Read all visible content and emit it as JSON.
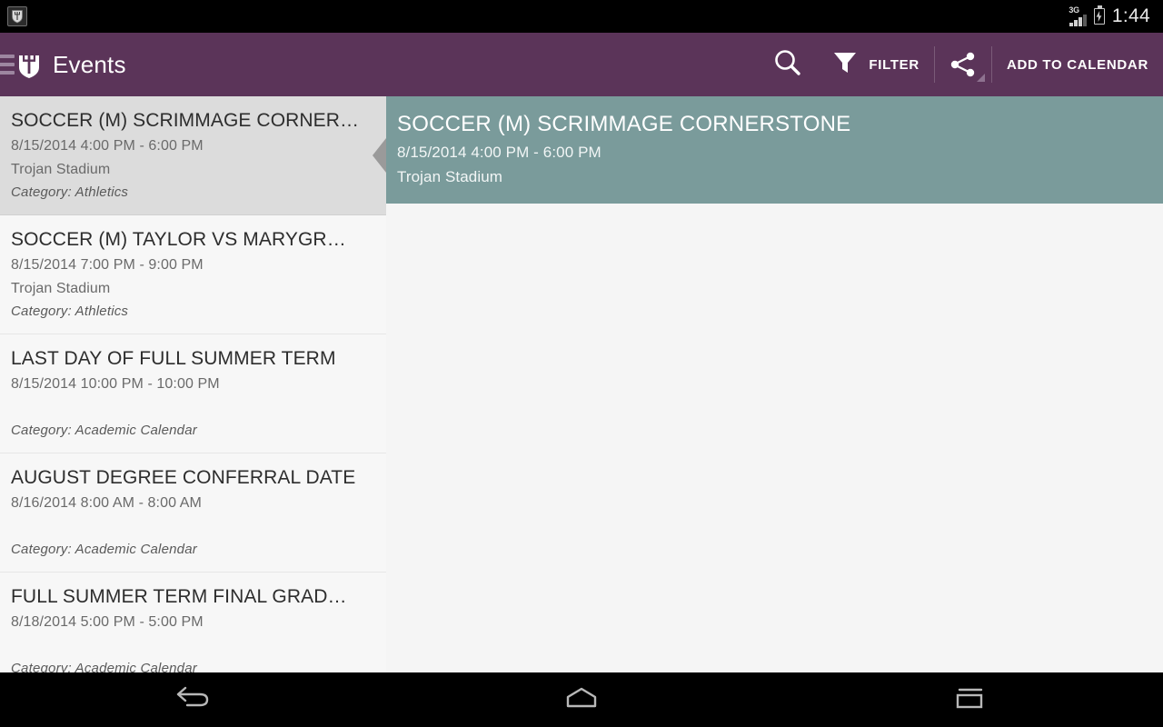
{
  "status_bar": {
    "notification_icon": "app-shield-trident-icon",
    "signal_type": "3G",
    "signal_icon": "cell-signal-icon",
    "battery_icon": "battery-charging-icon",
    "time": "1:44"
  },
  "action_bar": {
    "menu_icon": "hamburger-menu-icon",
    "logo_icon": "shield-trident-logo-icon",
    "title": "Events",
    "search_icon": "search-icon",
    "filter_icon": "filter-funnel-icon",
    "filter_label": "FILTER",
    "share_icon": "share-icon",
    "share_caret_icon": "dropdown-caret-icon",
    "add_to_calendar_label": "ADD TO CALENDAR",
    "background_color": "#5b3459"
  },
  "event_list": {
    "items": [
      {
        "title": "SOCCER (M) SCRIMMAGE CORNER…",
        "date": "8/15/2014 4:00 PM - 6:00 PM",
        "location": "Trojan Stadium",
        "category": "Category:  Athletics",
        "selected": true
      },
      {
        "title": "SOCCER (M) TAYLOR VS MARYGR…",
        "date": "8/15/2014 7:00 PM - 9:00 PM",
        "location": "Trojan Stadium",
        "category": "Category:  Athletics",
        "selected": false
      },
      {
        "title": "LAST DAY OF FULL SUMMER TERM",
        "date": "8/15/2014 10:00 PM - 10:00 PM",
        "location": "",
        "category": "Category:  Academic Calendar",
        "selected": false
      },
      {
        "title": "AUGUST DEGREE CONFERRAL DATE",
        "date": "8/16/2014 8:00 AM - 8:00 AM",
        "location": "",
        "category": "Category:  Academic Calendar",
        "selected": false
      },
      {
        "title": "FULL SUMMER TERM FINAL GRAD…",
        "date": "8/18/2014 5:00 PM - 5:00 PM",
        "location": "",
        "category": "Category:  Academic Calendar",
        "selected": false
      }
    ]
  },
  "detail": {
    "title": "SOCCER (M) SCRIMMAGE CORNERSTONE",
    "date": "8/15/2014 4:00 PM - 6:00 PM",
    "location": "Trojan Stadium",
    "header_color": "#7a9b9b"
  },
  "nav_bar": {
    "back_icon": "back-arrow-icon",
    "home_icon": "home-icon",
    "recents_icon": "recent-apps-icon"
  }
}
